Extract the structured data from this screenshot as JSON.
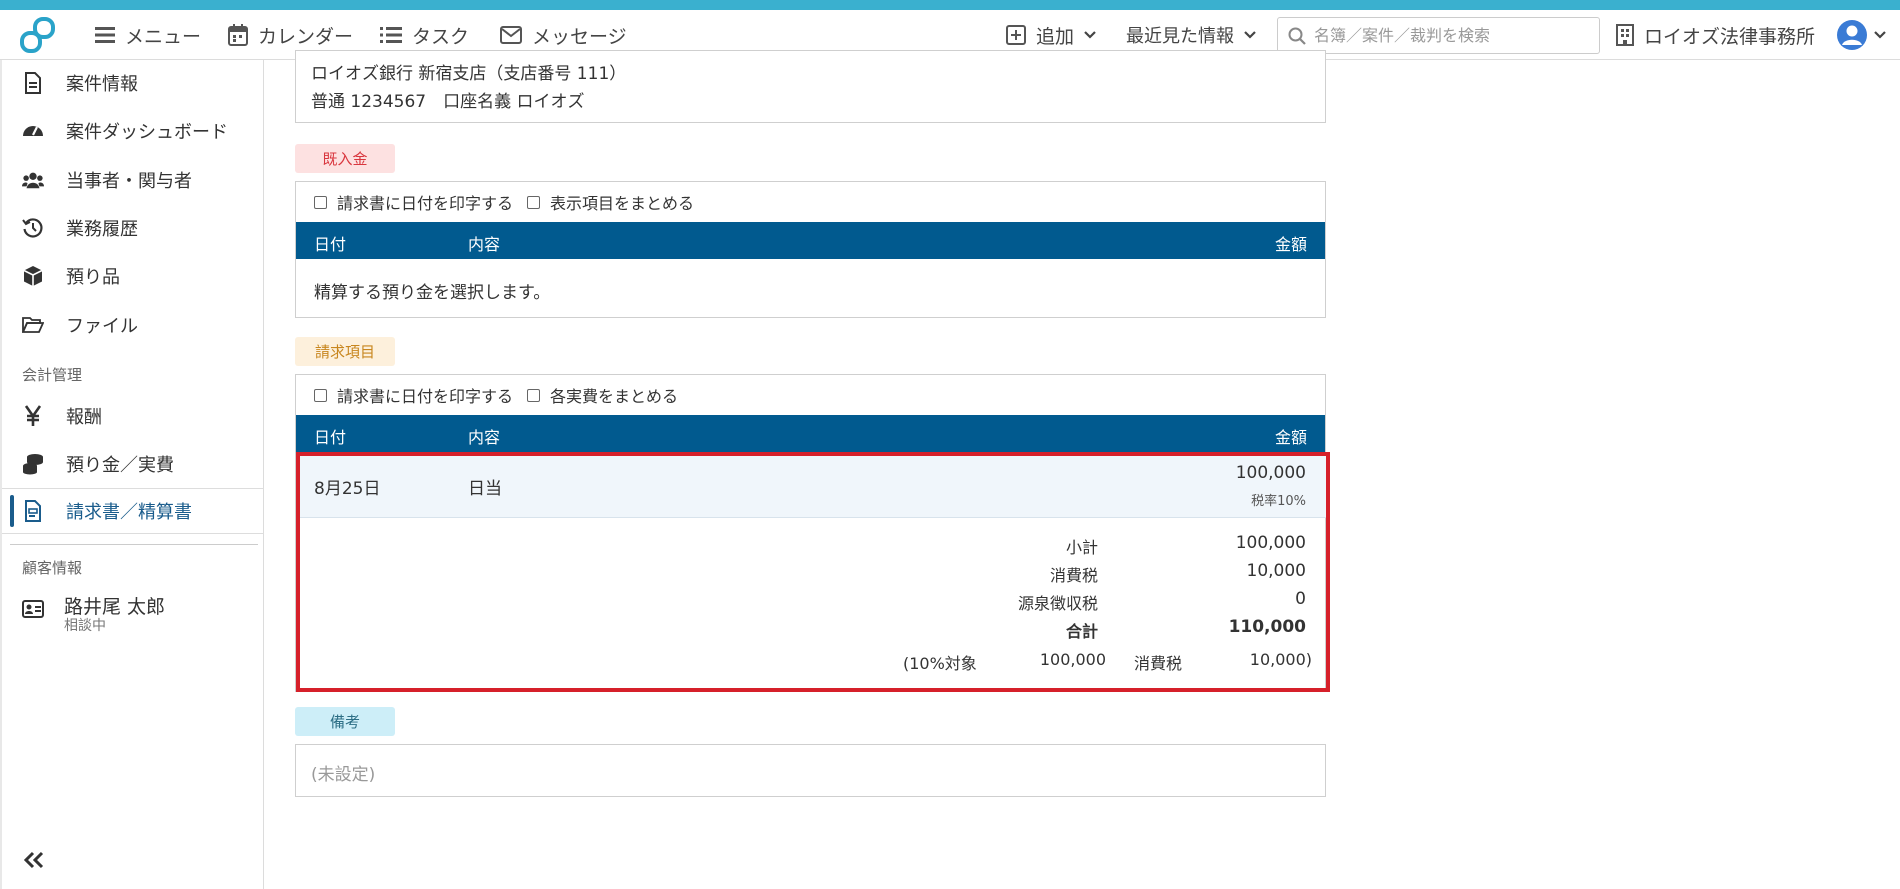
{
  "topbar": {
    "menu": "メニュー",
    "calendar": "カレンダー",
    "task": "タスク",
    "messages": "メッセージ",
    "add": "追加",
    "recent": "最近見た情報",
    "search_placeholder": "名簿／案件／裁判を検索",
    "office": "ロイオズ法律事務所"
  },
  "sidebar": {
    "items": [
      {
        "label": "案件情報",
        "icon": "document-icon"
      },
      {
        "label": "案件ダッシュボード",
        "icon": "gauge-icon"
      },
      {
        "label": "当事者・関与者",
        "icon": "users-icon"
      },
      {
        "label": "業務履歴",
        "icon": "history-icon"
      },
      {
        "label": "預り品",
        "icon": "box-icon"
      },
      {
        "label": "ファイル",
        "icon": "folder-icon"
      }
    ],
    "section_accounting": "会計管理",
    "accounting_items": [
      {
        "label": "報酬",
        "icon": "yen-icon"
      },
      {
        "label": "預り金／実費",
        "icon": "coins-icon"
      },
      {
        "label": "請求書／精算書",
        "icon": "invoice-icon"
      }
    ],
    "section_client": "顧客情報",
    "client": {
      "name": "路井尾 太郎",
      "status": "相談中"
    }
  },
  "bank": {
    "line1": "ロイオズ銀行 新宿支店（支店番号 111）",
    "line2": "普通 1234567　口座名義 ロイオズ"
  },
  "deposit": {
    "badge": "既入金",
    "opt1": "請求書に日付を印字する",
    "opt2": "表示項目をまとめる",
    "col_date": "日付",
    "col_content": "内容",
    "col_amount": "金額",
    "empty": "精算する預り金を選択します。"
  },
  "billing": {
    "badge": "請求項目",
    "opt1": "請求書に日付を印字する",
    "opt2": "各実費をまとめる",
    "col_date": "日付",
    "col_content": "内容",
    "col_amount": "金額",
    "row": {
      "date": "8月25日",
      "content": "日当",
      "amount": "100,000",
      "tax_rate": "税率10%"
    },
    "summary": {
      "subtotal_label": "小計",
      "subtotal": "100,000",
      "tax_label": "消費税",
      "tax": "10,000",
      "withholding_label": "源泉徴収税",
      "withholding": "0",
      "total_label": "合計",
      "total": "110,000",
      "breakdown_prefix": "(10%対象",
      "breakdown_base": "100,000",
      "breakdown_tax_label": "消費税",
      "breakdown_tax": "10,000)"
    }
  },
  "notes": {
    "badge": "備考",
    "value": "(未設定)"
  },
  "colors": {
    "accent": "#015a8f",
    "highlight": "#d6202a",
    "top_stripe": "#3ab0cf"
  }
}
